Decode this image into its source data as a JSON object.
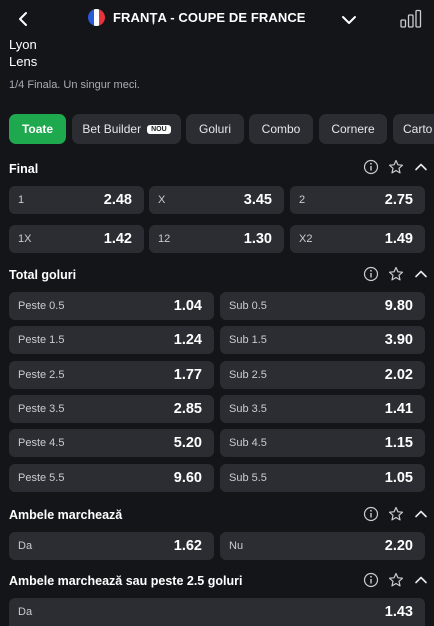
{
  "header": {
    "title": "FRANȚA - COUPE DE FRANCE",
    "flag_colors": [
      "#2a5bd7",
      "#ffffff",
      "#e8323c"
    ]
  },
  "match": {
    "home": "Lyon",
    "away": "Lens",
    "info": "1/4 Finala. Un singur meci."
  },
  "tabs": [
    {
      "label": "Toate"
    },
    {
      "label": "Bet Builder",
      "badge": "NOU"
    },
    {
      "label": "Goluri"
    },
    {
      "label": "Combo"
    },
    {
      "label": "Cornere"
    },
    {
      "label": "Carto"
    }
  ],
  "markets": {
    "final": {
      "title": "Final",
      "rows": [
        [
          {
            "label": "1",
            "odd": "2.48"
          },
          {
            "label": "X",
            "odd": "3.45"
          },
          {
            "label": "2",
            "odd": "2.75"
          }
        ],
        [
          {
            "label": "1X",
            "odd": "1.42"
          },
          {
            "label": "12",
            "odd": "1.30"
          },
          {
            "label": "X2",
            "odd": "1.49"
          }
        ]
      ]
    },
    "total_goals": {
      "title": "Total goluri",
      "rows": [
        [
          {
            "label": "Peste 0.5",
            "odd": "1.04"
          },
          {
            "label": "Sub 0.5",
            "odd": "9.80"
          }
        ],
        [
          {
            "label": "Peste 1.5",
            "odd": "1.24"
          },
          {
            "label": "Sub 1.5",
            "odd": "3.90"
          }
        ],
        [
          {
            "label": "Peste 2.5",
            "odd": "1.77"
          },
          {
            "label": "Sub 2.5",
            "odd": "2.02"
          }
        ],
        [
          {
            "label": "Peste 3.5",
            "odd": "2.85"
          },
          {
            "label": "Sub 3.5",
            "odd": "1.41"
          }
        ],
        [
          {
            "label": "Peste 4.5",
            "odd": "5.20"
          },
          {
            "label": "Sub 4.5",
            "odd": "1.15"
          }
        ],
        [
          {
            "label": "Peste 5.5",
            "odd": "9.60"
          },
          {
            "label": "Sub 5.5",
            "odd": "1.05"
          }
        ]
      ]
    },
    "btts": {
      "title": "Ambele marchează",
      "rows": [
        [
          {
            "label": "Da",
            "odd": "1.62"
          },
          {
            "label": "Nu",
            "odd": "2.20"
          }
        ]
      ]
    },
    "btts_over": {
      "title": "Ambele marchează sau peste 2.5 goluri",
      "rows": [
        [
          {
            "label": "Da",
            "odd": "1.43"
          }
        ]
      ]
    }
  },
  "icons": {
    "back": "chevron-left-icon",
    "dropdown": "chevron-down-icon",
    "stats": "stats-bars-icon",
    "info": "info-icon",
    "favorite": "star-icon",
    "collapse": "chevron-up-icon"
  }
}
